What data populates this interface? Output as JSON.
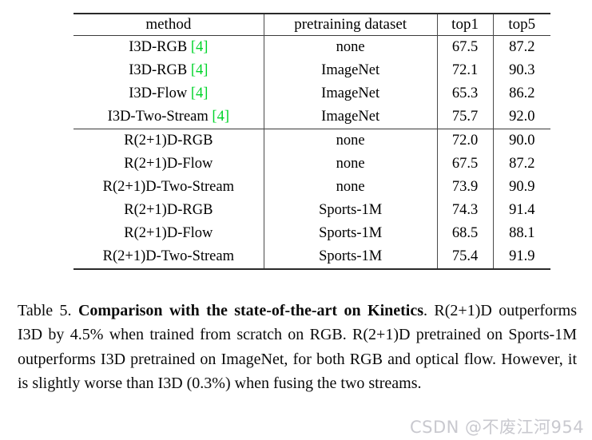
{
  "table": {
    "columns": [
      "method",
      "pretraining dataset",
      "top1",
      "top5"
    ],
    "groups": [
      {
        "rows": [
          {
            "method": "I3D-RGB",
            "citation": "[4]",
            "dataset": "none",
            "top1": "67.5",
            "top5": "87.2",
            "bold": false
          },
          {
            "method": "I3D-RGB",
            "citation": "[4]",
            "dataset": "ImageNet",
            "top1": "72.1",
            "top5": "90.3",
            "bold": false
          },
          {
            "method": "I3D-Flow",
            "citation": "[4]",
            "dataset": "ImageNet",
            "top1": "65.3",
            "top5": "86.2",
            "bold": false
          },
          {
            "method": "I3D-Two-Stream",
            "citation": "[4]",
            "dataset": "ImageNet",
            "top1": "75.7",
            "top5": "92.0",
            "bold": true
          }
        ]
      },
      {
        "rows": [
          {
            "method": "R(2+1)D-RGB",
            "citation": "",
            "dataset": "none",
            "top1": "72.0",
            "top5": "90.0",
            "bold": false
          },
          {
            "method": "R(2+1)D-Flow",
            "citation": "",
            "dataset": "none",
            "top1": "67.5",
            "top5": "87.2",
            "bold": false
          },
          {
            "method": "R(2+1)D-Two-Stream",
            "citation": "",
            "dataset": "none",
            "top1": "73.9",
            "top5": "90.9",
            "bold": false
          },
          {
            "method": "R(2+1)D-RGB",
            "citation": "",
            "dataset": "Sports-1M",
            "top1": "74.3",
            "top5": "91.4",
            "bold": false
          },
          {
            "method": "R(2+1)D-Flow",
            "citation": "",
            "dataset": "Sports-1M",
            "top1": "68.5",
            "top5": "88.1",
            "bold": false
          },
          {
            "method": "R(2+1)D-Two-Stream",
            "citation": "",
            "dataset": "Sports-1M",
            "top1": "75.4",
            "top5": "91.9",
            "bold": true
          }
        ]
      }
    ]
  },
  "caption": {
    "label": "Table 5. ",
    "title": "Comparison with the state-of-the-art on Kinetics",
    "body": ". R(2+1)D outperforms I3D by 4.5% when trained from scratch on RGB. R(2+1)D pretrained on Sports-1M outperforms I3D pretrained on ImageNet, for both RGB and optical flow. However, it is slightly worse than I3D (0.3%) when fusing the two streams."
  },
  "watermark": {
    "text": "CSDN @不废江河954"
  },
  "colors": {
    "citation_green": "#00d42a",
    "rule": "#2a2a2a",
    "watermark": "#c9c9cf",
    "text": "#000000"
  }
}
